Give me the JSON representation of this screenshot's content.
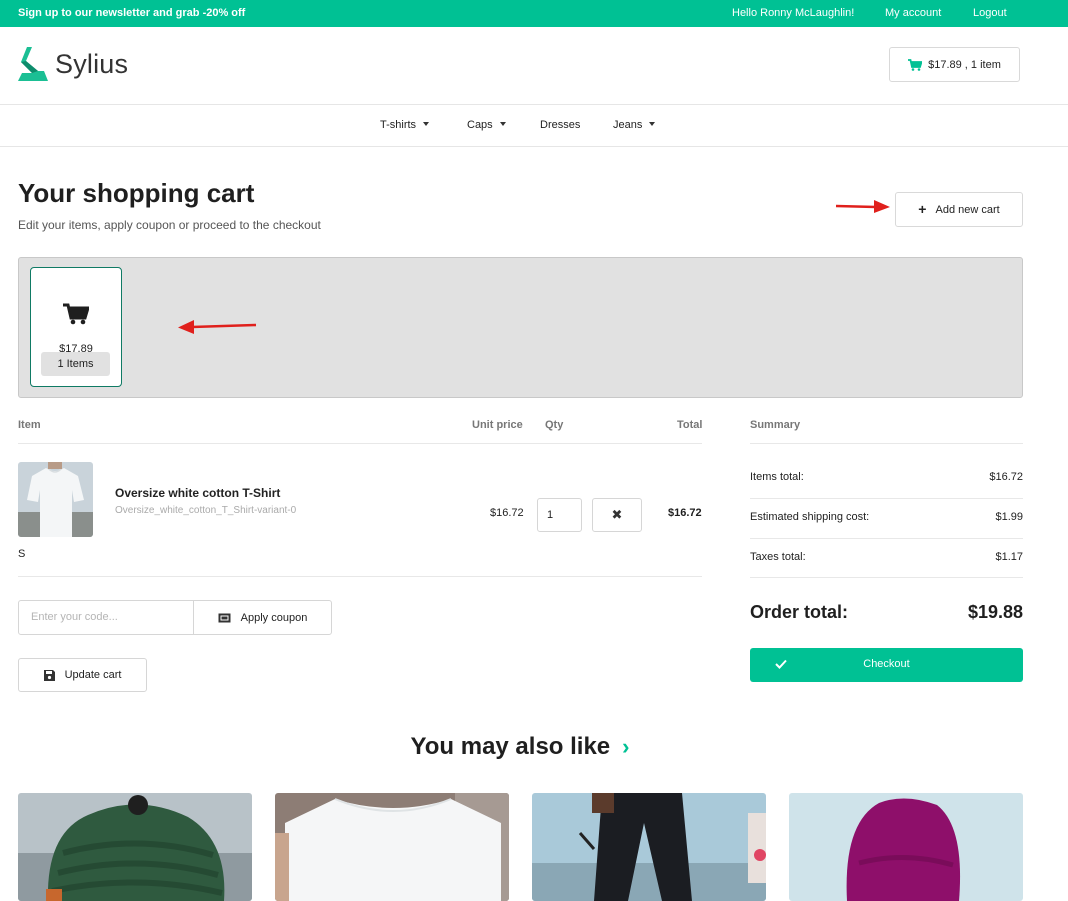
{
  "topbar": {
    "promo": "Sign up to our newsletter and grab -20% off",
    "greeting": "Hello Ronny McLaughlin!",
    "my_account": "My account",
    "logout": "Logout"
  },
  "header": {
    "logo_text": "Sylius",
    "cart_summary": "$17.89 , 1 item"
  },
  "nav": {
    "items": [
      {
        "label": "T-shirts",
        "has_dropdown": true
      },
      {
        "label": "Caps",
        "has_dropdown": true
      },
      {
        "label": "Dresses",
        "has_dropdown": false
      },
      {
        "label": "Jeans",
        "has_dropdown": true
      }
    ]
  },
  "page": {
    "title": "Your shopping cart",
    "subtitle": "Edit your items, apply coupon or proceed to the checkout",
    "add_new_cart": "Add new cart"
  },
  "carts": [
    {
      "amount": "$17.89",
      "items_label": "1 Items",
      "active": true
    }
  ],
  "table": {
    "headers": {
      "item": "Item",
      "unit_price": "Unit price",
      "qty": "Qty",
      "total": "Total"
    },
    "rows": [
      {
        "name": "Oversize white cotton T-Shirt",
        "variant": "Oversize_white_cotton_T_Shirt-variant-0",
        "option": "S",
        "unit_price": "$16.72",
        "qty": "1",
        "total": "$16.72"
      }
    ]
  },
  "coupon": {
    "placeholder": "Enter your code...",
    "apply_label": "Apply coupon"
  },
  "update_label": "Update cart",
  "summary": {
    "heading": "Summary",
    "rows": [
      {
        "label": "Items total:",
        "value": "$16.72"
      },
      {
        "label": "Estimated shipping cost:",
        "value": "$1.99"
      },
      {
        "label": "Taxes total:",
        "value": "$1.17"
      }
    ],
    "order_total_label": "Order total:",
    "order_total_value": "$19.88",
    "checkout_label": "Checkout"
  },
  "recommendations": {
    "title": "You may also like",
    "chevron": "›"
  },
  "colors": {
    "brand": "#00c194",
    "annotation_arrow": "#e0201c",
    "active_cart_border": "#0f7a64"
  }
}
